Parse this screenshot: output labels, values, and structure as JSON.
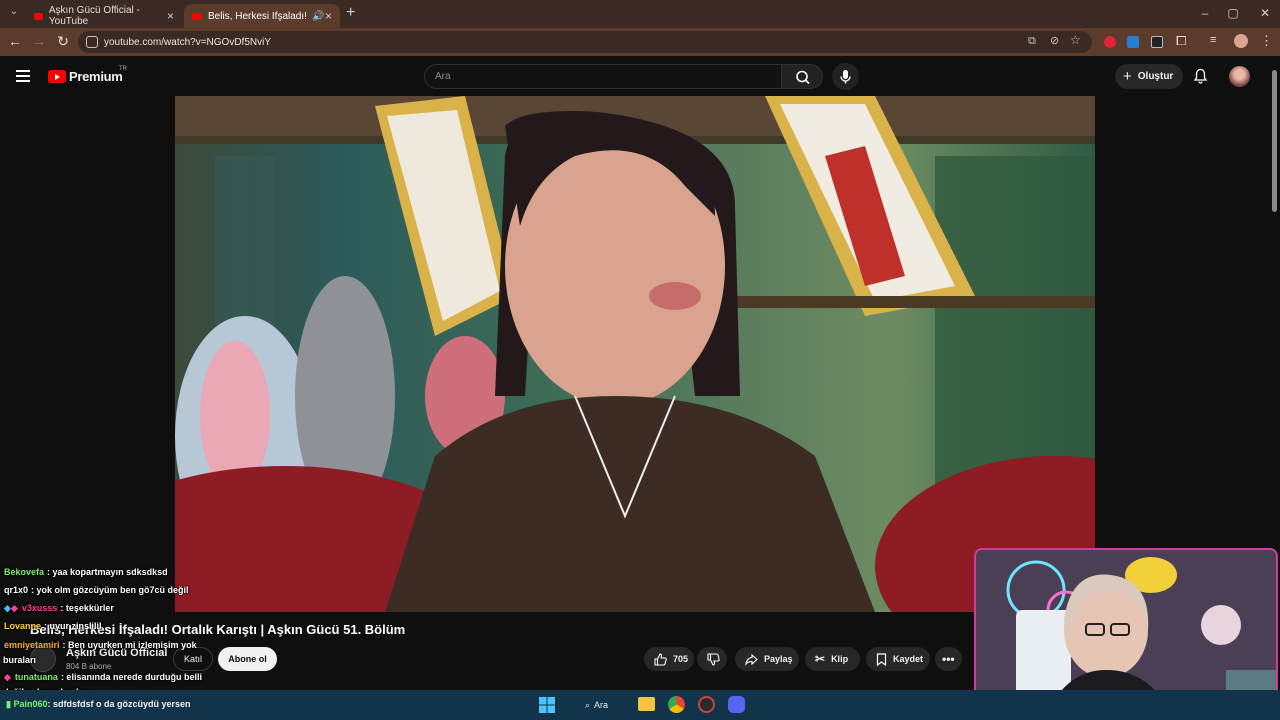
{
  "browser": {
    "tabs": [
      {
        "title": "Aşkın Gücü Official - YouTube",
        "active": false
      },
      {
        "title": "Belis, Herkesi İfşaladı! Ortal",
        "active": true
      }
    ],
    "url": "youtube.com/watch?v=NGOvDf5NviY"
  },
  "youtube": {
    "logo_text": "Premium",
    "logo_region": "TR",
    "search_placeholder": "Ara",
    "create_label": "Oluştur"
  },
  "video": {
    "title": "Belis, Herkesi İfşaladı! Ortalık Karıştı | Aşkın Gücü 51. Bölüm",
    "channel_name": "Aşkın Gücü Official",
    "subscribers": "804 B abone",
    "join_label": "Katıl",
    "subscribe_label": "Abone ol",
    "likes": "705",
    "share_label": "Paylaş",
    "clip_label": "Klip",
    "save_label": "Kaydet"
  },
  "chat": [
    {
      "user": "Bekovefa",
      "text": ": yaa kopartmayın sdksdksd",
      "color": "#7cf06a"
    },
    {
      "user": "qr1x0",
      "text": ": yok olm gözcüyüm ben gö7cü değil",
      "color": "#ffffff"
    },
    {
      "user": "v3xusss",
      "text": ": teşekkürler",
      "color": "#ff3c9a"
    },
    {
      "user": "Lovanne",
      "text": ": uyur zinslilil",
      "color": "#ffd23a"
    },
    {
      "user": "emniyetamiri",
      "text": ": Ben uyurken mi izlemişim yok",
      "color": "#ffb020"
    },
    {
      "user": "buraları",
      "text": "",
      "color": "#ffffff"
    },
    {
      "user": "tunatuana",
      "text": ": elisanında nerede durduğu belli",
      "color": "#7cf06a"
    },
    {
      "user": "",
      "text": "değil anlamadım ben",
      "color": "#ffffff"
    }
  ],
  "taskbar": {
    "search_label": "Ara",
    "chat_user": "Pain060",
    "chat_text": ": sdfdsfdsf o da gözcüydü yersen"
  },
  "colors": {
    "accent": "#ff0000",
    "webcam_border": "#d23aa0",
    "taskbar": "#12344a"
  }
}
